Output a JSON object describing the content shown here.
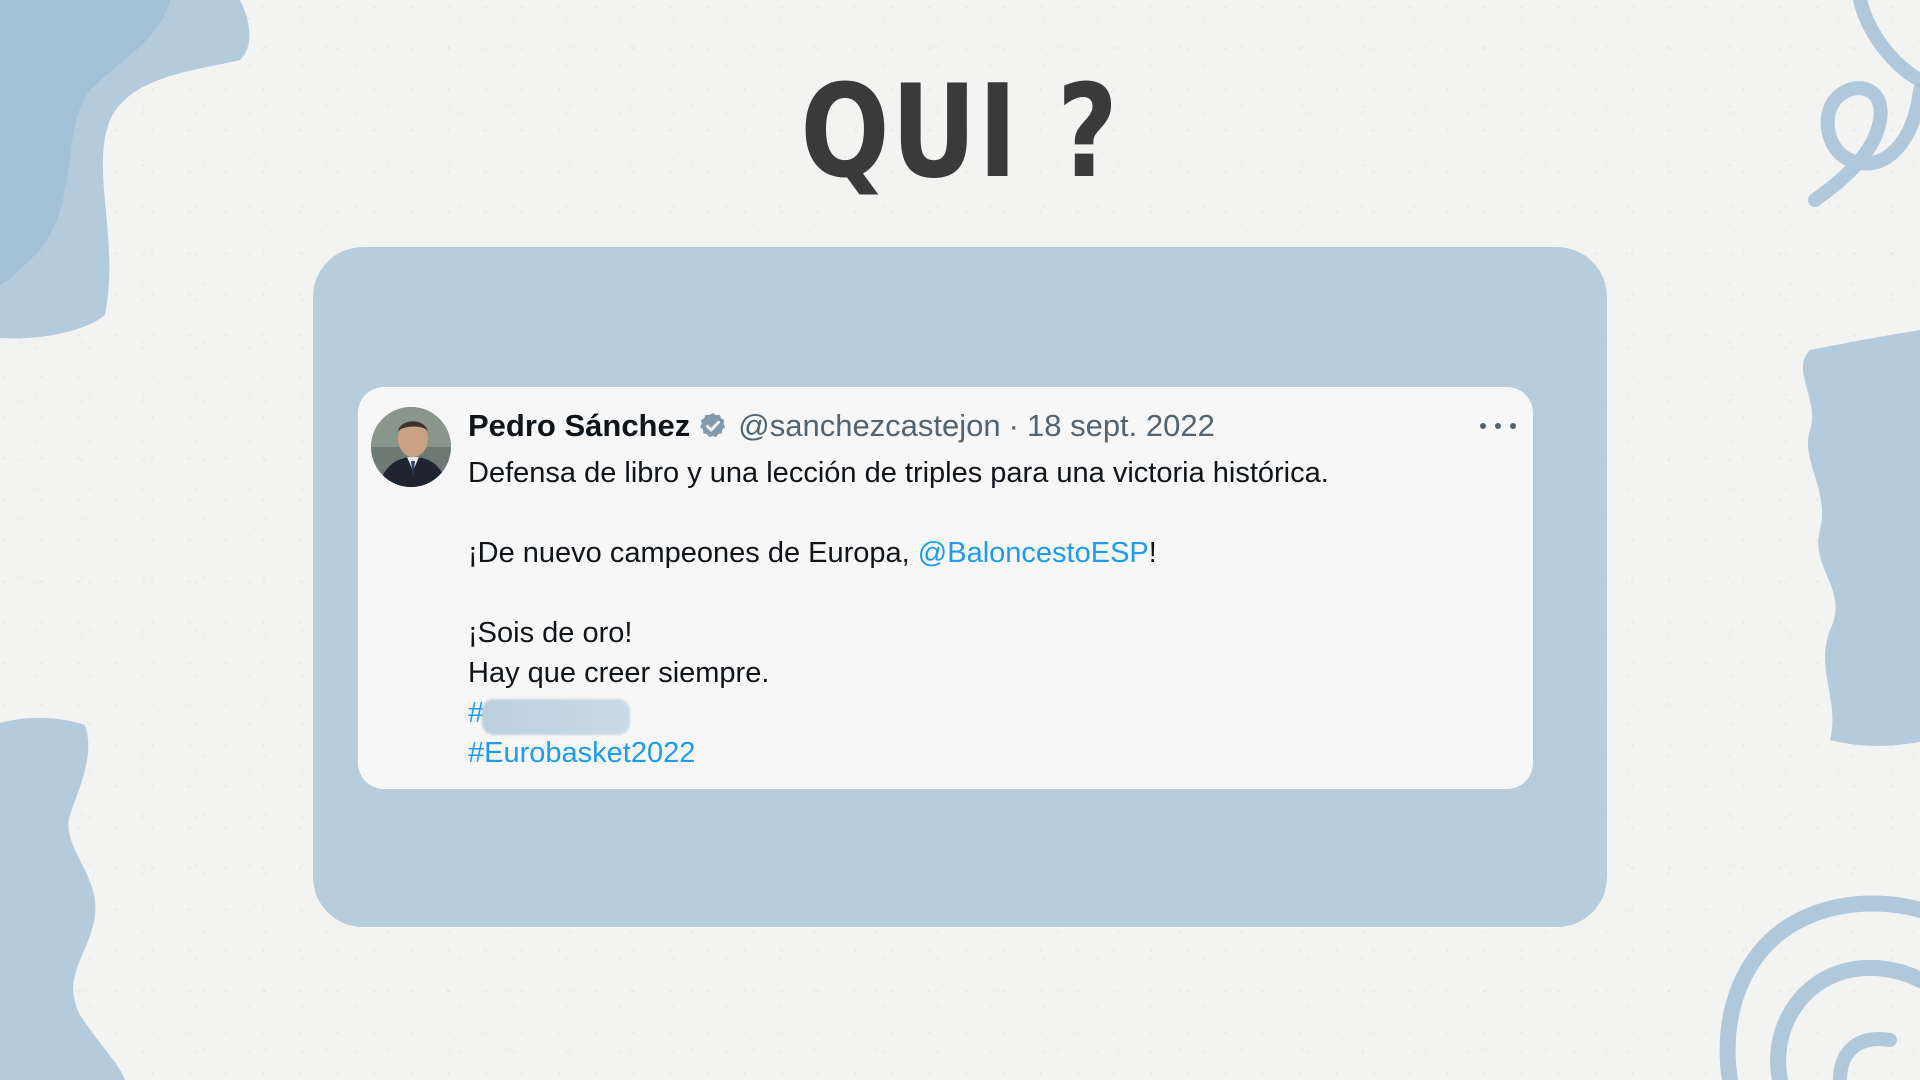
{
  "slide": {
    "title": "QUI ?"
  },
  "tweet": {
    "author": "Pedro Sánchez",
    "handle": "@sanchezcastejon",
    "separator": "·",
    "date": "18 sept. 2022",
    "verified_icon": "verified-badge-icon",
    "more_icon": "more-options-icon",
    "lines": {
      "line1": "Defensa de libro y una lección de triples para una victoria histórica.",
      "line2_prefix": "¡De nuevo campeones de Europa, ",
      "line2_mention": "@BaloncestoESP",
      "line2_suffix": "!",
      "line3": "¡Sois de oro!",
      "line4": "Hay que creer siempre.",
      "hashtag1": "#",
      "hashtag2": "#Eurobasket2022"
    }
  },
  "colors": {
    "panel": "#b7cddc",
    "link": "#1d9bf0",
    "title": "#3a3a3a",
    "decor": "#9dbdd6"
  }
}
